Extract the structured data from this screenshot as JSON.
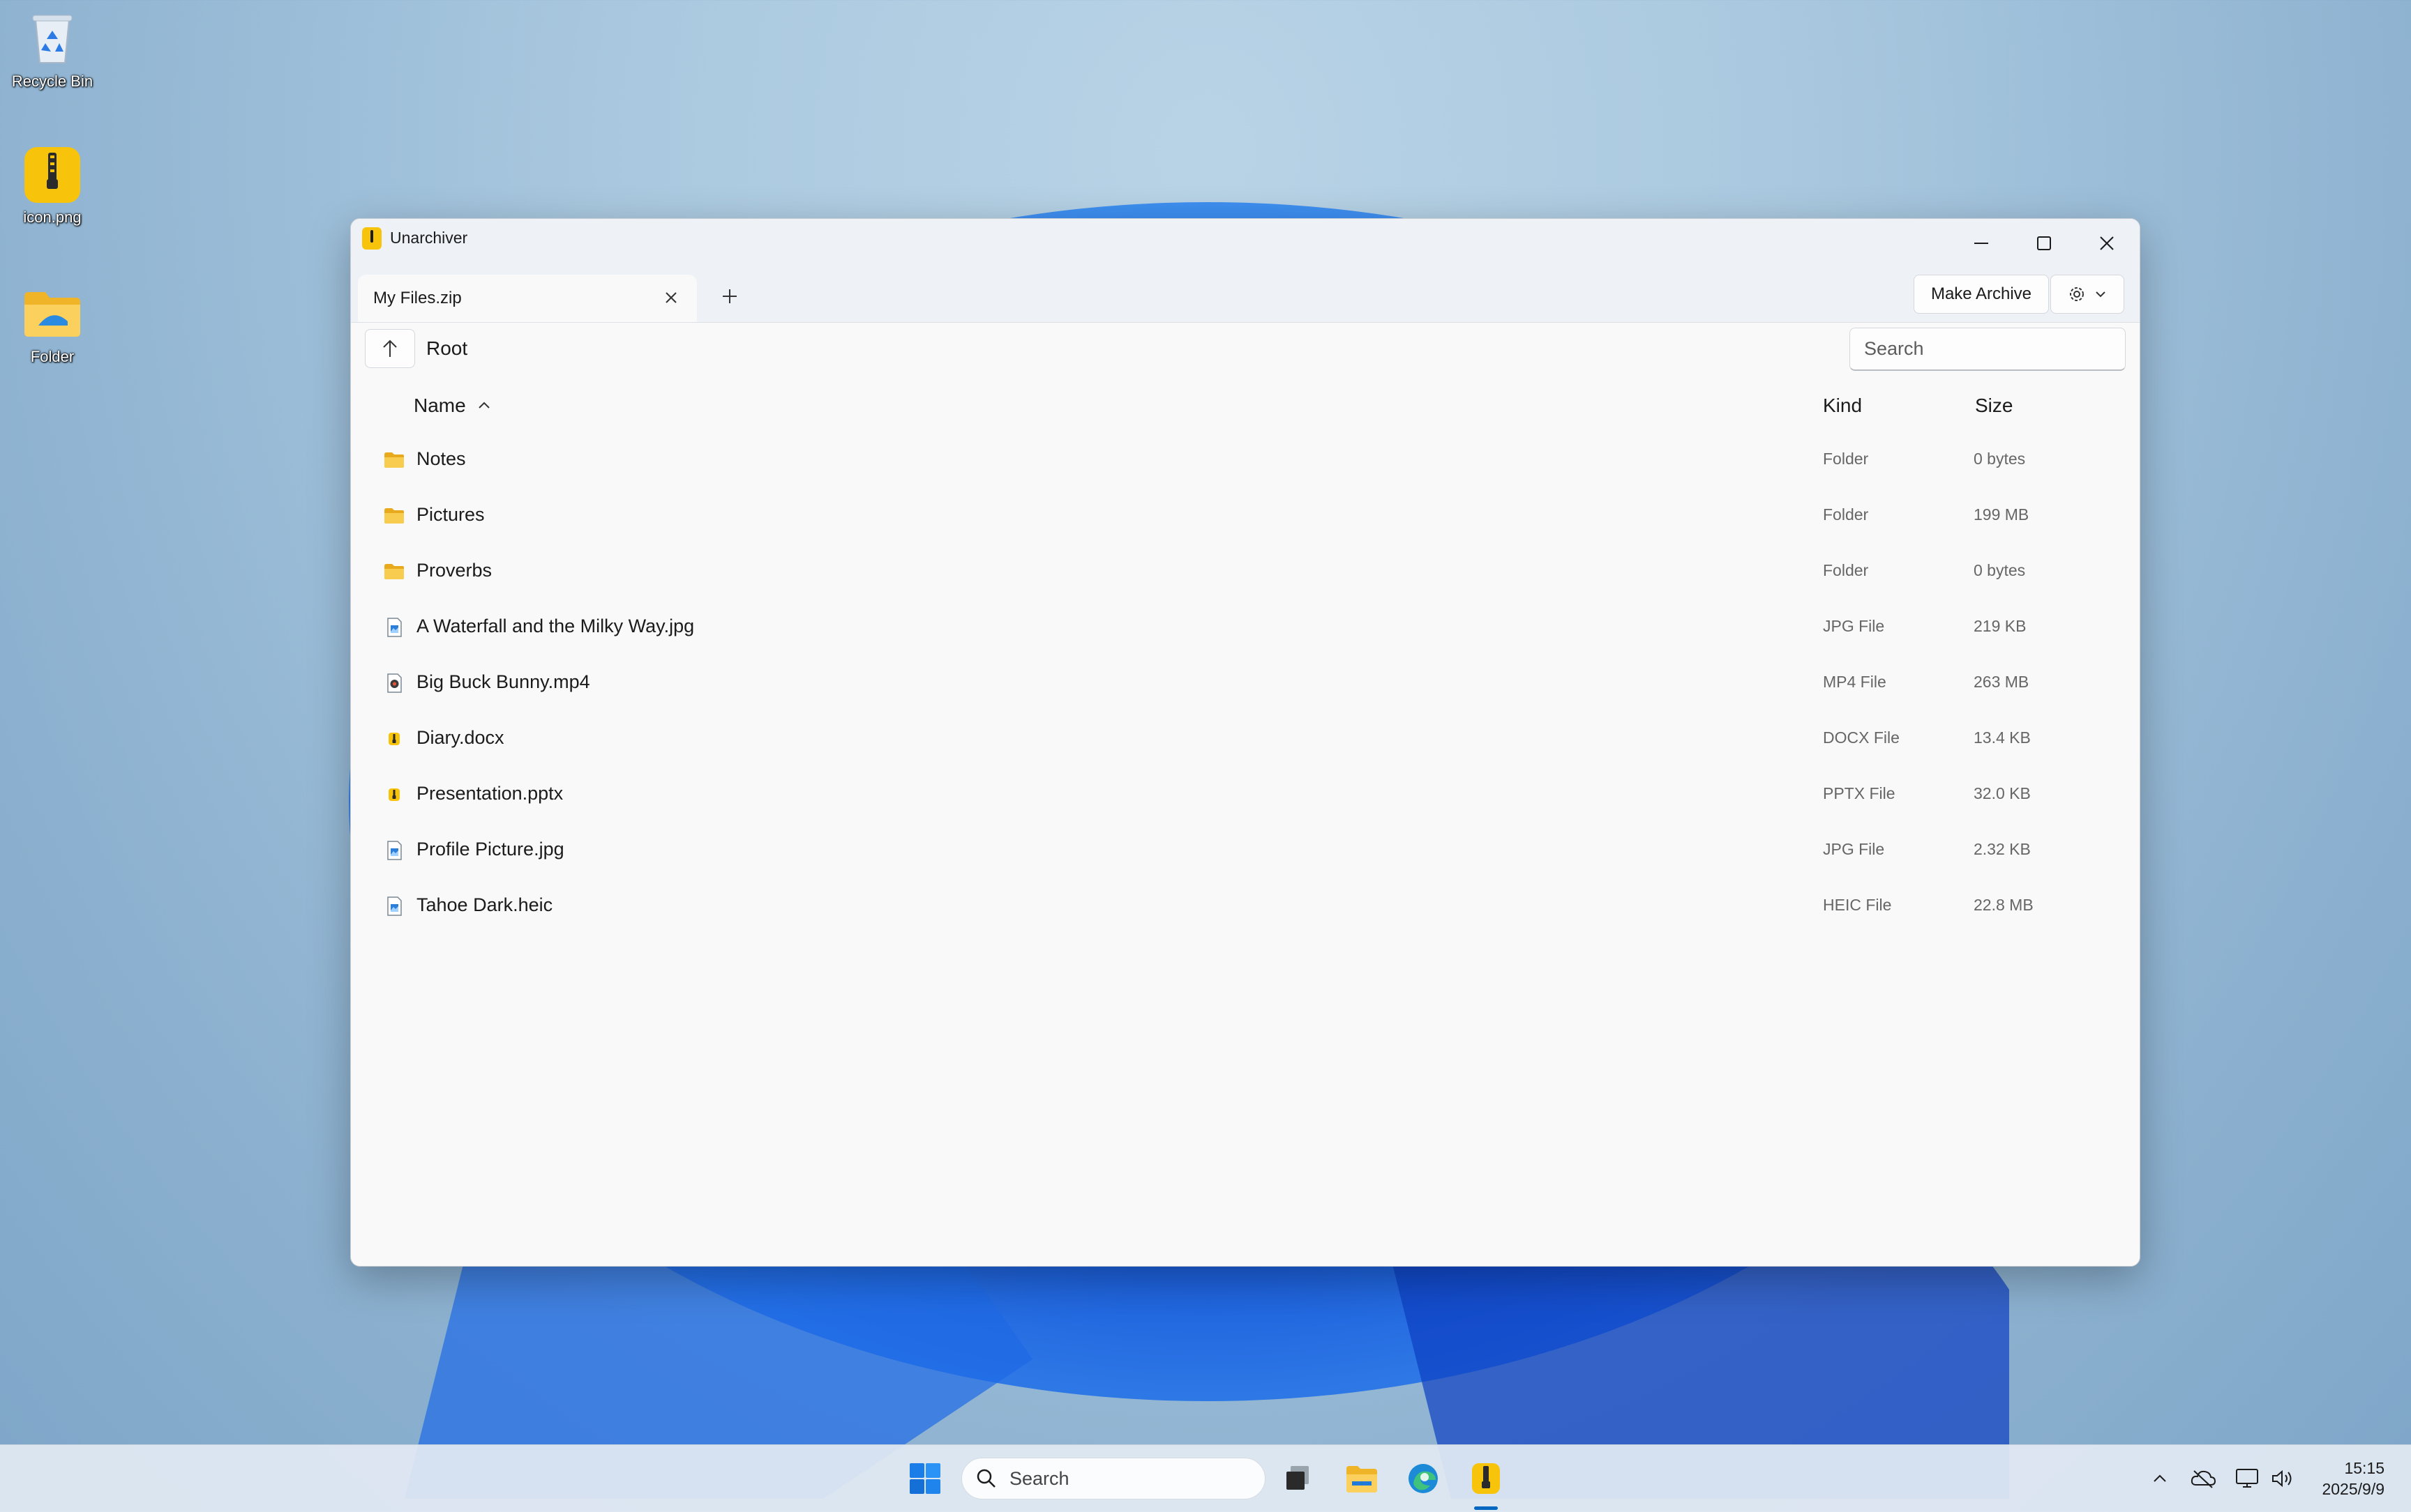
{
  "desktop": {
    "icons": [
      {
        "label": "Recycle Bin",
        "icon": "recycle-bin-icon"
      },
      {
        "label": "icon.png",
        "icon": "zip-archive-icon"
      },
      {
        "label": "Folder",
        "icon": "folder-icon"
      }
    ]
  },
  "window": {
    "title": "Unarchiver",
    "controls": {
      "minimize": "minimize-icon",
      "maximize": "maximize-icon",
      "close": "close-icon"
    },
    "tabs": [
      {
        "label": "My Files.zip",
        "active": true
      }
    ],
    "new_tab_icon": "plus-icon",
    "toolbar": {
      "make_archive_label": "Make Archive",
      "settings_icon": "gear-icon"
    },
    "nav": {
      "up_icon": "arrow-up-icon",
      "breadcrumb": "Root",
      "search_placeholder": "Search"
    },
    "columns": {
      "name": "Name",
      "kind": "Kind",
      "size": "Size",
      "sort": "ascending"
    },
    "files": [
      {
        "name": "Notes",
        "kind": "Folder",
        "size": "0 bytes",
        "icon": "folder-icon"
      },
      {
        "name": "Pictures",
        "kind": "Folder",
        "size": "199 MB",
        "icon": "folder-icon"
      },
      {
        "name": "Proverbs",
        "kind": "Folder",
        "size": "0 bytes",
        "icon": "folder-icon"
      },
      {
        "name": "A Waterfall and the Milky Way.jpg",
        "kind": "JPG File",
        "size": "219 KB",
        "icon": "image-file-icon"
      },
      {
        "name": "Big Buck Bunny.mp4",
        "kind": "MP4 File",
        "size": "263 MB",
        "icon": "video-file-icon"
      },
      {
        "name": "Diary.docx",
        "kind": "DOCX File",
        "size": "13.4 KB",
        "icon": "archive-file-icon"
      },
      {
        "name": "Presentation.pptx",
        "kind": "PPTX File",
        "size": "32.0 KB",
        "icon": "archive-file-icon"
      },
      {
        "name": "Profile Picture.jpg",
        "kind": "JPG File",
        "size": "2.32 KB",
        "icon": "image-file-icon"
      },
      {
        "name": "Tahoe Dark.heic",
        "kind": "HEIC File",
        "size": "22.8 MB",
        "icon": "image-file-icon"
      }
    ]
  },
  "taskbar": {
    "search_placeholder": "Search",
    "apps": [
      "start-icon",
      "task-view-icon",
      "file-explorer-icon",
      "edge-icon",
      "unarchiver-icon"
    ],
    "tray": [
      "chevron-up-icon",
      "cloud-offline-icon",
      "network-icon",
      "volume-icon"
    ],
    "time": "15:15",
    "date": "2025/9/9"
  },
  "colors": {
    "accent": "#0067c0",
    "folder": "#f5c542",
    "window_bg": "#f9f9f9"
  }
}
